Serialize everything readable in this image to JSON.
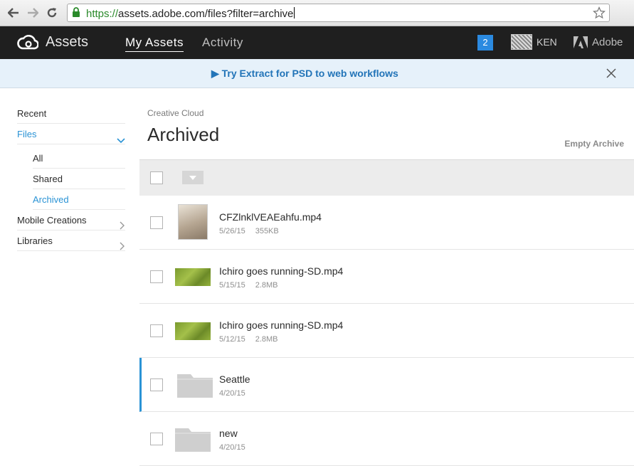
{
  "browser": {
    "url_scheme": "https://",
    "url_rest": "assets.adobe.com/files?filter=archive",
    "icons": [
      "back-icon",
      "forward-icon",
      "reload-icon",
      "lock-icon",
      "star-icon"
    ]
  },
  "header": {
    "app_name": "Assets",
    "nav": [
      {
        "label": "My Assets",
        "active": true
      },
      {
        "label": "Activity",
        "active": false
      }
    ],
    "notification_count": "2",
    "user": "KEN",
    "brand": "Adobe"
  },
  "promo": {
    "label": "▶ Try Extract for PSD to web workflows"
  },
  "sidebar": {
    "items": [
      {
        "label": "Recent"
      },
      {
        "label": "Files",
        "active": true,
        "expanded": true
      },
      {
        "label": "All"
      },
      {
        "label": "Shared"
      },
      {
        "label": "Archived",
        "active": true
      },
      {
        "label": "Mobile Creations"
      },
      {
        "label": "Libraries"
      }
    ]
  },
  "main": {
    "breadcrumb": "Creative Cloud",
    "title": "Archived",
    "empty_action": "Empty Archive",
    "files": [
      {
        "name": "CFZlnklVEAEahfu.mp4",
        "date": "5/26/15",
        "size": "355KB",
        "thumb": "photo"
      },
      {
        "name": "Ichiro goes running-SD.mp4",
        "date": "5/15/15",
        "size": "2.8MB",
        "thumb": "video"
      },
      {
        "name": "Ichiro goes running-SD.mp4",
        "date": "5/12/15",
        "size": "2.8MB",
        "thumb": "video"
      },
      {
        "name": "Seattle",
        "date": "4/20/15",
        "size": "",
        "thumb": "folder",
        "selected": true
      },
      {
        "name": "new",
        "date": "4/20/15",
        "size": "",
        "thumb": "folder"
      }
    ]
  },
  "colors": {
    "accent": "#2a93d5",
    "header_bg": "#1f1f1f",
    "promo_bg": "#e6f1fa"
  }
}
